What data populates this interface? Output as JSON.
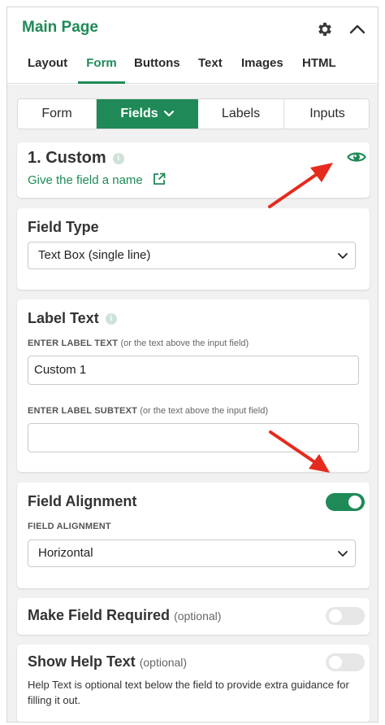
{
  "header": {
    "title": "Main Page",
    "tabs": [
      "Layout",
      "Form",
      "Buttons",
      "Text",
      "Images",
      "HTML"
    ],
    "active_tab": "Form"
  },
  "segments": {
    "items": [
      "Form",
      "Fields",
      "Labels",
      "Inputs"
    ],
    "active": "Fields"
  },
  "field": {
    "title": "1. Custom",
    "link": "Give the field a name"
  },
  "field_type": {
    "title": "Field Type",
    "value": "Text Box (single line)"
  },
  "label_text": {
    "title": "Label Text",
    "label_caption": "ENTER LABEL TEXT",
    "label_hint": "(or the text above the input field)",
    "label_value": "Custom 1",
    "subtext_caption": "ENTER LABEL SUBTEXT",
    "subtext_hint": "(or the text above the input field)",
    "subtext_value": ""
  },
  "alignment": {
    "title": "Field Alignment",
    "caption": "FIELD ALIGNMENT",
    "value": "Horizontal",
    "toggle_on": true
  },
  "required": {
    "title": "Make Field Required",
    "optional": "(optional)",
    "toggle_on": false
  },
  "help": {
    "title": "Show Help Text",
    "optional": "(optional)",
    "description": "Help Text is optional text below the field to provide extra guidance for filling it out.",
    "toggle_on": false
  },
  "colors": {
    "accent": "#1f8a57",
    "annotation_arrow": "#e52b1e"
  }
}
